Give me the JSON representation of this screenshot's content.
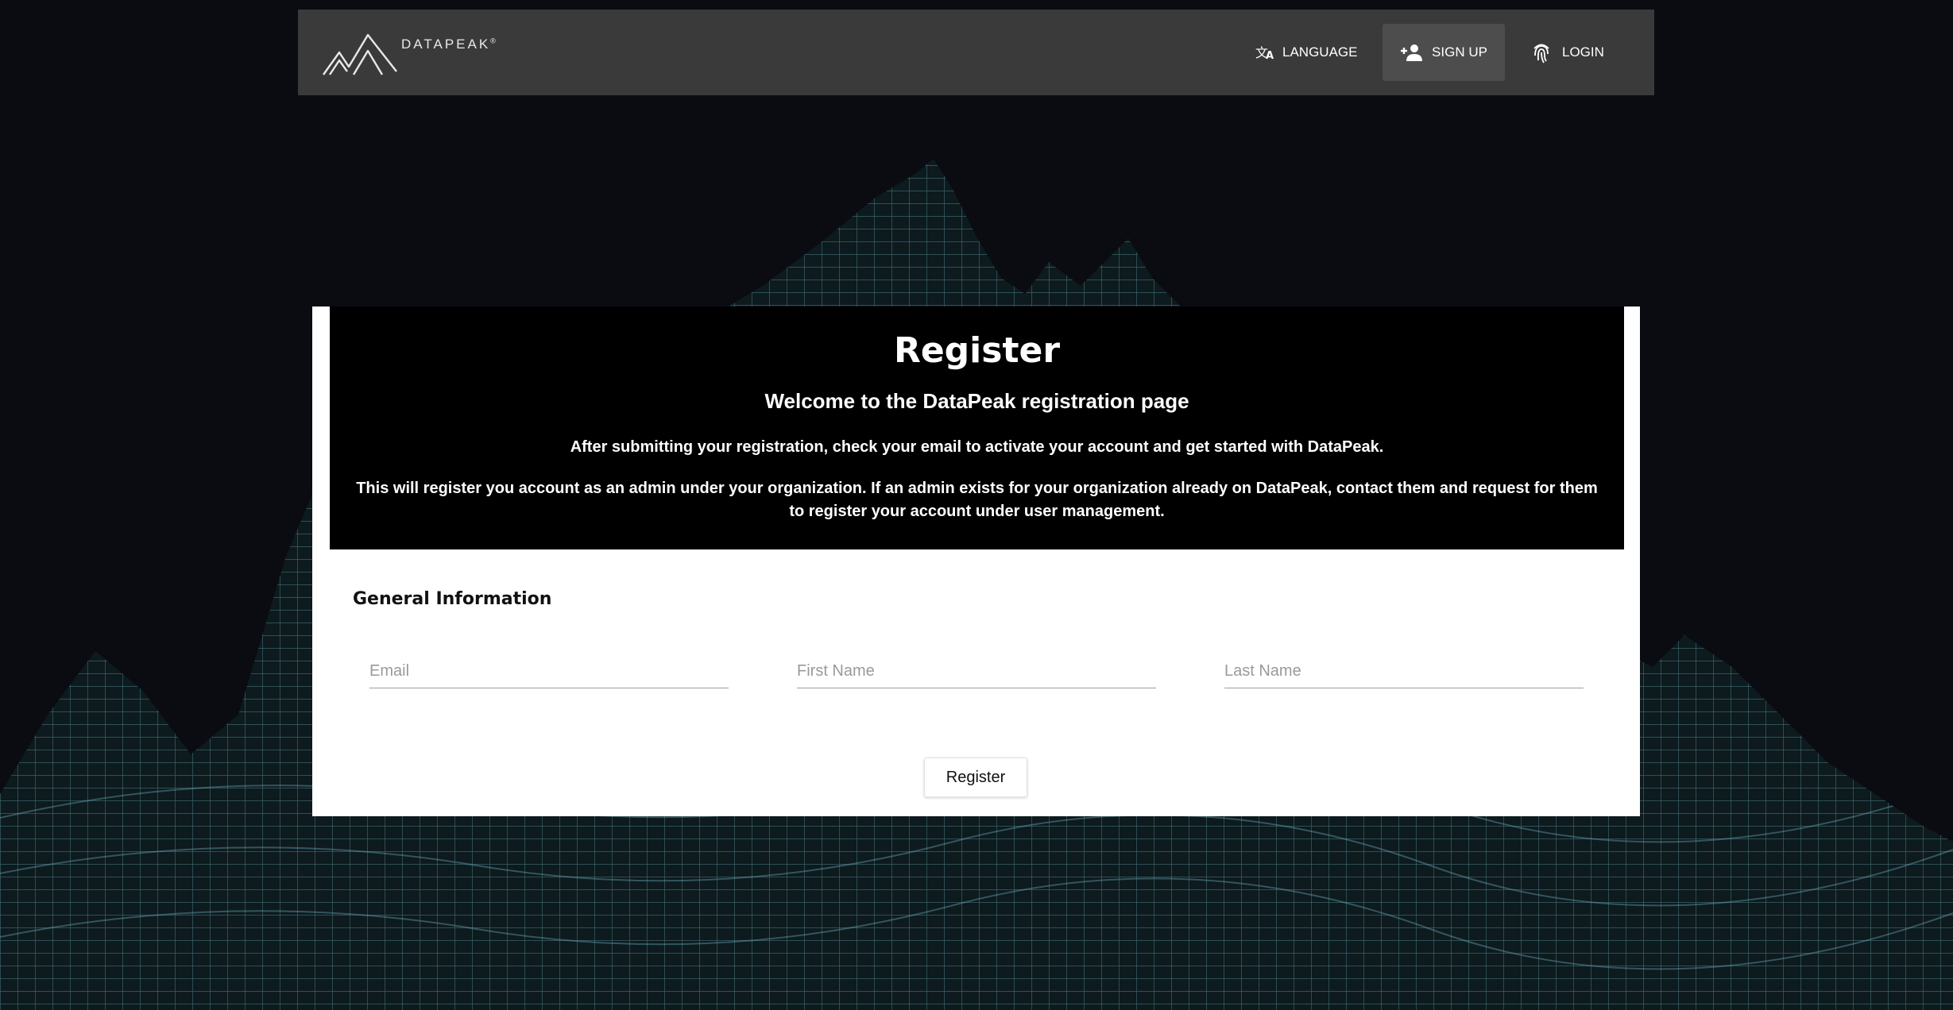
{
  "brand": {
    "logo_text": "DATAPEAK",
    "logo_mark": "®"
  },
  "nav": {
    "language_label": "LANGUAGE",
    "signup_label": "SIGN UP",
    "login_label": "LOGIN",
    "icons": {
      "language": "translate-icon",
      "signup": "person-add-icon",
      "login": "fingerprint-icon"
    }
  },
  "card": {
    "title": "Register",
    "subtitle": "Welcome to the DataPeak registration page",
    "paragraph_1": "After submitting your registration, check your email to activate your account and get started with DataPeak.",
    "paragraph_2": "This will register you account as an admin under your organization. If an admin exists for your organization already on DataPeak, contact them and request for them to register your account under user management."
  },
  "form": {
    "section_title": "General Information",
    "email": {
      "value": "",
      "placeholder": "Email"
    },
    "first_name": {
      "value": "",
      "placeholder": "First Name"
    },
    "last_name": {
      "value": "",
      "placeholder": "Last Name"
    },
    "submit_label": "Register"
  },
  "colors": {
    "page_background": "#0a0c12",
    "navbar": "#3a3a3a",
    "signup_active": "#4d4d4d",
    "card_header": "#000000",
    "mesh": "#5f9aa3"
  }
}
